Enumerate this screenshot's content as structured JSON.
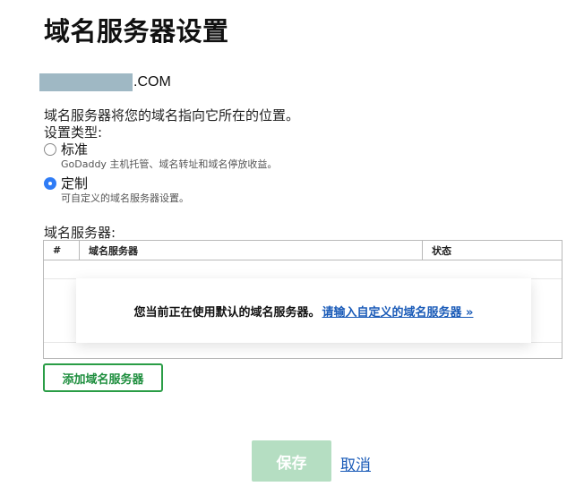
{
  "page": {
    "title": "域名服务器设置",
    "domain_tld": ".COM",
    "description": "域名服务器将您的域名指向它所在的位置。",
    "type_label": "设置类型:"
  },
  "options": {
    "standard": {
      "label": "标准",
      "sub": "GoDaddy 主机托管、域名转址和域名停放收益。",
      "selected": false
    },
    "custom": {
      "label": "定制",
      "sub": "可自定义的域名服务器设置。",
      "selected": true
    }
  },
  "nameservers": {
    "label": "域名服务器:",
    "columns": [
      "#",
      "域名服务器",
      "状态"
    ],
    "empty_text": "您当前正在使用默认的域名服务器。",
    "empty_link": "请输入自定义的域名服务器 »",
    "add_button": "添加域名服务器"
  },
  "actions": {
    "save": "保存",
    "cancel": "取消"
  },
  "colors": {
    "accent_blue": "#2f7cf6",
    "link_blue": "#1a5bb8",
    "green": "#2a9d46",
    "save_disabled": "#b5dec2"
  }
}
